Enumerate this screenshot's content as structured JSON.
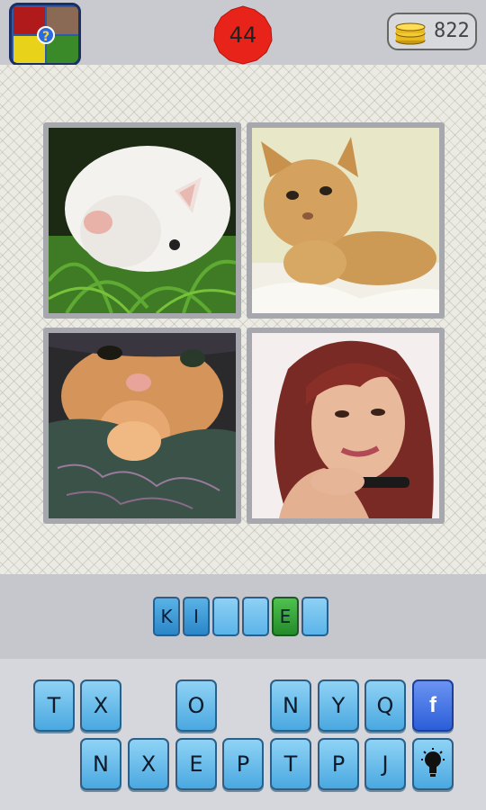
{
  "header": {
    "level": "44",
    "coins": "822"
  },
  "answer": {
    "slots": [
      "K",
      "I",
      "",
      "",
      "E",
      ""
    ]
  },
  "keyboard": {
    "row1": [
      "T",
      "X",
      "",
      "O",
      "",
      "N",
      "Y",
      "Q"
    ],
    "row2": [
      "",
      "N",
      "X",
      "E",
      "P",
      "T",
      "P",
      "J"
    ],
    "facebook_label": "f"
  },
  "colors": {
    "badge": "#e8231a",
    "key": "#5ab2e6",
    "hint": "#2fa33a",
    "facebook": "#2b5ed8"
  },
  "icons": [
    "app-logo-icon",
    "coins-icon",
    "facebook-icon",
    "lightbulb-icon"
  ]
}
